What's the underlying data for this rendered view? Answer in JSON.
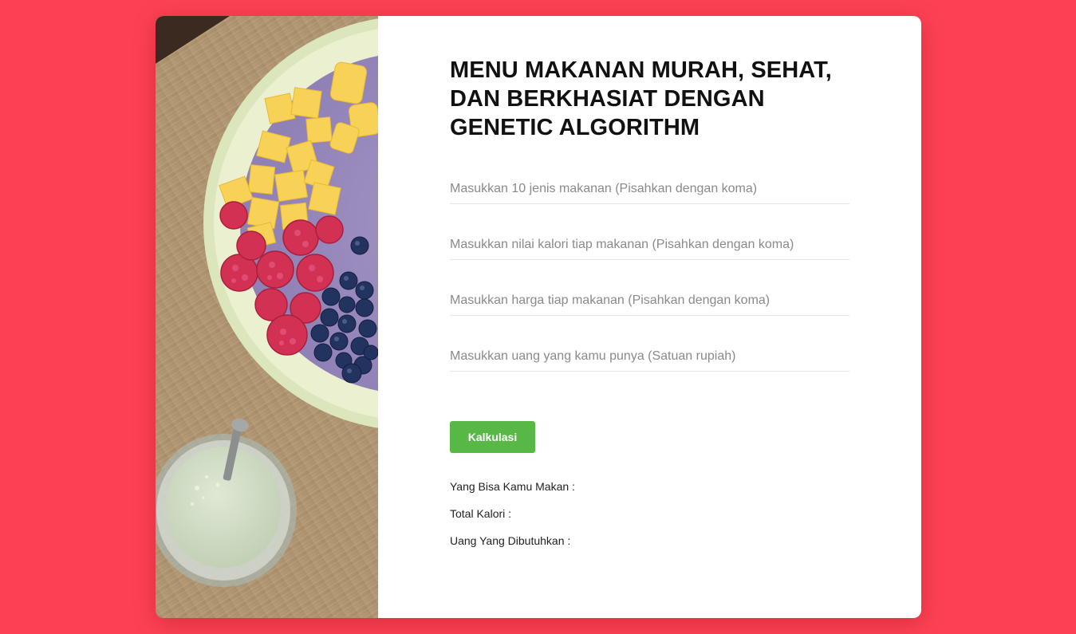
{
  "colors": {
    "background": "#fd4152",
    "button": "#57b846",
    "title": "#111111"
  },
  "header": {
    "title": "MENU MAKANAN MURAH, SEHAT, DAN BERKHASIAT DENGAN GENETIC ALGORITHM"
  },
  "form": {
    "fields": [
      {
        "name": "makanan",
        "value": "",
        "placeholder": "Masukkan 10 jenis makanan (Pisahkan dengan koma)"
      },
      {
        "name": "kalori",
        "value": "",
        "placeholder": "Masukkan nilai kalori tiap makanan (Pisahkan dengan koma)"
      },
      {
        "name": "harga",
        "value": "",
        "placeholder": "Masukkan harga tiap makanan (Pisahkan dengan koma)"
      },
      {
        "name": "uang",
        "value": "",
        "placeholder": "Masukkan uang yang kamu punya (Satuan rupiah)"
      }
    ],
    "submit_label": "Kalkulasi"
  },
  "results": {
    "makanan_label": "Yang Bisa Kamu Makan :",
    "kalori_label": "Total Kalori :",
    "uang_label": "Uang Yang Dibutuhkan :"
  },
  "image": {
    "subject": "smoothie-bowl-photo"
  }
}
